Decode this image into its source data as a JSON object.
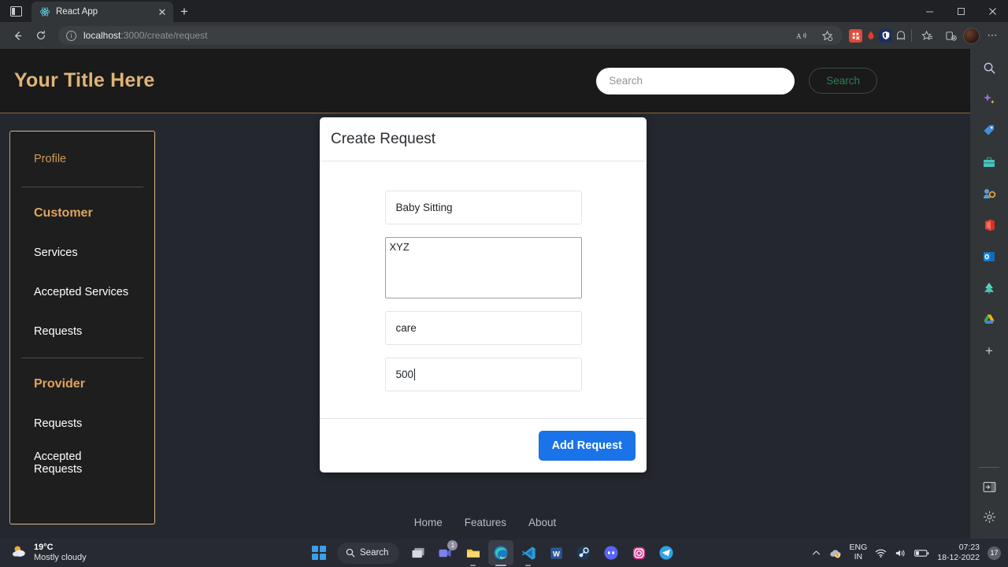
{
  "browser": {
    "tab": {
      "title": "React App",
      "favicon_icon": "react-icon",
      "close_icon": "close-icon"
    },
    "tab_search_icon": "tab-search-icon",
    "new_tab_icon": "plus-icon",
    "window_controls": {
      "minimize": "—",
      "maximize": "❐",
      "close": "✕"
    },
    "nav": {
      "back_icon": "back-arrow-icon",
      "reload_icon": "reload-icon"
    },
    "omnibox": {
      "info_icon": "info-icon",
      "url_host": "localhost",
      "url_path": ":3000/create/request",
      "read_aloud_icon": "read-aloud-icon",
      "favorite_icon": "favorite-star-icon"
    },
    "extensions": [
      {
        "name": "extension-icon-red",
        "color": "#d94a3a",
        "glyph": "▦"
      },
      {
        "name": "adblock-icon",
        "color": "#1f1f1f",
        "glyph": "●"
      },
      {
        "name": "bitwarden-icon",
        "color": "#1c3f7a",
        "glyph": "⚑"
      },
      {
        "name": "ghost-extension-icon",
        "color": "#323639",
        "glyph": "○"
      }
    ],
    "collections_icon": "collections-icon",
    "favorites_icon": "favorites-icon",
    "profile_avatar": "avatar",
    "more_icon": "more-options-icon"
  },
  "page": {
    "header": {
      "title": "Your Title Here",
      "search_placeholder": "Search",
      "search_value": "",
      "search_button": "Search"
    },
    "sidebar": {
      "profile": "Profile",
      "sections": [
        {
          "heading": "Customer",
          "items": [
            "Services",
            "Accepted Services",
            "Requests"
          ]
        },
        {
          "heading": "Provider",
          "items": [
            "Requests",
            "Accepted Requests"
          ]
        }
      ]
    },
    "card": {
      "title": "Create Request",
      "fields": [
        {
          "name": "service-name-input",
          "value": "Baby Sitting",
          "type": "text"
        },
        {
          "name": "description-textarea",
          "value": "XYZ",
          "type": "textarea"
        },
        {
          "name": "category-input",
          "value": "care",
          "type": "text"
        },
        {
          "name": "price-input",
          "value": "500",
          "type": "text"
        }
      ],
      "submit_button": "Add Request"
    },
    "footer_links": [
      "Home",
      "Features",
      "About"
    ]
  },
  "edge_sidebar": {
    "icons": [
      {
        "name": "search-icon",
        "glyph": "🔍"
      },
      {
        "name": "copilot-sparkle-icon",
        "glyph": "✦"
      },
      {
        "name": "shopping-tag-icon",
        "glyph": "🏷"
      },
      {
        "name": "tools-briefcase-icon",
        "glyph": "🧰"
      },
      {
        "name": "games-icon",
        "glyph": "🎮"
      },
      {
        "name": "office-icon",
        "glyph": "◑"
      },
      {
        "name": "outlook-icon",
        "glyph": "✉"
      },
      {
        "name": "dropbox-tree-icon",
        "glyph": "🌲"
      },
      {
        "name": "google-drive-icon",
        "glyph": "▲"
      },
      {
        "name": "add-sidebar-app-icon",
        "glyph": "＋"
      }
    ],
    "bottom": [
      {
        "name": "collapse-sidebar-icon",
        "glyph": "⬒"
      },
      {
        "name": "sidebar-settings-icon",
        "glyph": "⚙"
      }
    ]
  },
  "taskbar": {
    "weather": {
      "temperature": "19°C",
      "description": "Mostly cloudy",
      "icon": "partly-cloudy-icon"
    },
    "search_label": "Search",
    "search_icon": "search-icon",
    "start_icon": "start-icon",
    "apps": [
      {
        "name": "task-view-icon",
        "glyph": "❑",
        "badge": ""
      },
      {
        "name": "microsoft-teams-icon",
        "glyph": "📹",
        "badge": "1"
      },
      {
        "name": "file-explorer-icon",
        "glyph": "📁",
        "badge": ""
      },
      {
        "name": "microsoft-edge-icon",
        "glyph": "◔",
        "badge": ""
      },
      {
        "name": "vs-code-icon",
        "glyph": "〈",
        "badge": ""
      },
      {
        "name": "microsoft-word-icon",
        "glyph": "W",
        "badge": ""
      },
      {
        "name": "steam-icon",
        "glyph": "◎",
        "badge": ""
      },
      {
        "name": "discord-icon",
        "glyph": "●",
        "badge": ""
      },
      {
        "name": "instagram-icon",
        "glyph": "▣",
        "badge": ""
      },
      {
        "name": "telegram-icon",
        "glyph": "➤",
        "badge": ""
      }
    ],
    "tray": {
      "overflow_icon": "show-hidden-icons-icon",
      "onedrive_icon": "onedrive-sync-icon",
      "language": "ENG",
      "region": "IN",
      "wifi_icon": "wifi-icon",
      "volume_icon": "volume-icon",
      "battery_icon": "battery-icon",
      "time": "07:23",
      "date": "18-12-2022",
      "notification_count": "17"
    }
  }
}
